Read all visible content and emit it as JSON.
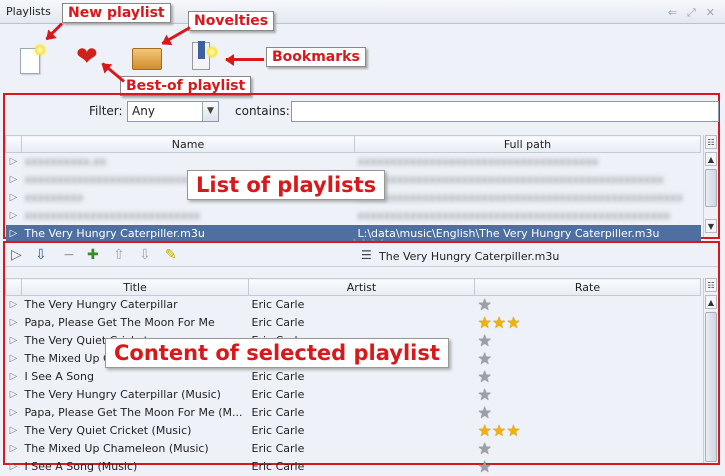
{
  "window": {
    "title": "Playlists"
  },
  "toolbar_icons": [
    "new-document-icon",
    "heart-icon",
    "open-box-icon",
    "bookmark-icon"
  ],
  "callouts": {
    "new_playlist": "New playlist",
    "novelties": "Novelties",
    "bookmarks": "Bookmarks",
    "best_of": "Best-of playlist",
    "list_of_playlists": "List of playlists",
    "content_selected": "Content of selected playlist"
  },
  "filter": {
    "label": "Filter:",
    "value": "Any",
    "contains_label": "contains:",
    "contains_value": ""
  },
  "playlists": {
    "columns": [
      "Name",
      "Full path"
    ],
    "rows": [
      {
        "name": "xxxxxxxxxx.xx",
        "path": "xxxxxxxxxxxxxxxxxxxxxxxxxxxxxxxxxxxxx",
        "blurred": true
      },
      {
        "name": "xxxxxxxxxxxxxxxxxxxxxxxxxx",
        "path": "xxxxxxxxxxxxxxxxxxxxxxxxxxxxxxxxxxxxxxxxxxxxxxx",
        "blurred": true
      },
      {
        "name": "xxxxxxxxx",
        "path": "xxxxxxxxxxxxxxxxxxxxxxxxxxxxxxxxxxxxxxxxxxxxxxxxxx",
        "blurred": true
      },
      {
        "name": "xxxxxxxxxxxxxxxxxxxxxxxxxxx",
        "path": "xxxxxxxxxxxxxxxxxxxxxxxxxxxxxxxxxxxxxxxxxxxxxxxx",
        "blurred": true
      },
      {
        "name": "The Very Hungry Caterpiller.m3u",
        "path": "L:\\data\\music\\English\\The Very Hungry Caterpiller.m3u",
        "blurred": false
      }
    ]
  },
  "content": {
    "current_playlist": "The Very Hungry Caterpiller.m3u",
    "columns": [
      "Title",
      "Artist",
      "Rate"
    ],
    "rows": [
      {
        "title": "The Very Hungry Caterpillar",
        "artist": "Eric Carle",
        "rate": 1
      },
      {
        "title": "Papa, Please Get The Moon For Me",
        "artist": "Eric Carle",
        "rate": 3
      },
      {
        "title": "The Very Quiet Cricket",
        "artist": "Eric Carle",
        "rate": 1
      },
      {
        "title": "The Mixed Up Chameleon",
        "artist": "Eric Carle",
        "rate": 1
      },
      {
        "title": "I See A Song",
        "artist": "Eric Carle",
        "rate": 1
      },
      {
        "title": "The Very Hungry Caterpillar (Music)",
        "artist": "Eric Carle",
        "rate": 1
      },
      {
        "title": "Papa, Please Get The Moon For Me (M...",
        "artist": "Eric Carle",
        "rate": 1
      },
      {
        "title": "The Very Quiet Cricket (Music)",
        "artist": "Eric Carle",
        "rate": 3
      },
      {
        "title": "The Mixed Up Chameleon (Music)",
        "artist": "Eric Carle",
        "rate": 1
      },
      {
        "title": "I See A Song (Music)",
        "artist": "Eric Carle",
        "rate": 1
      }
    ]
  }
}
